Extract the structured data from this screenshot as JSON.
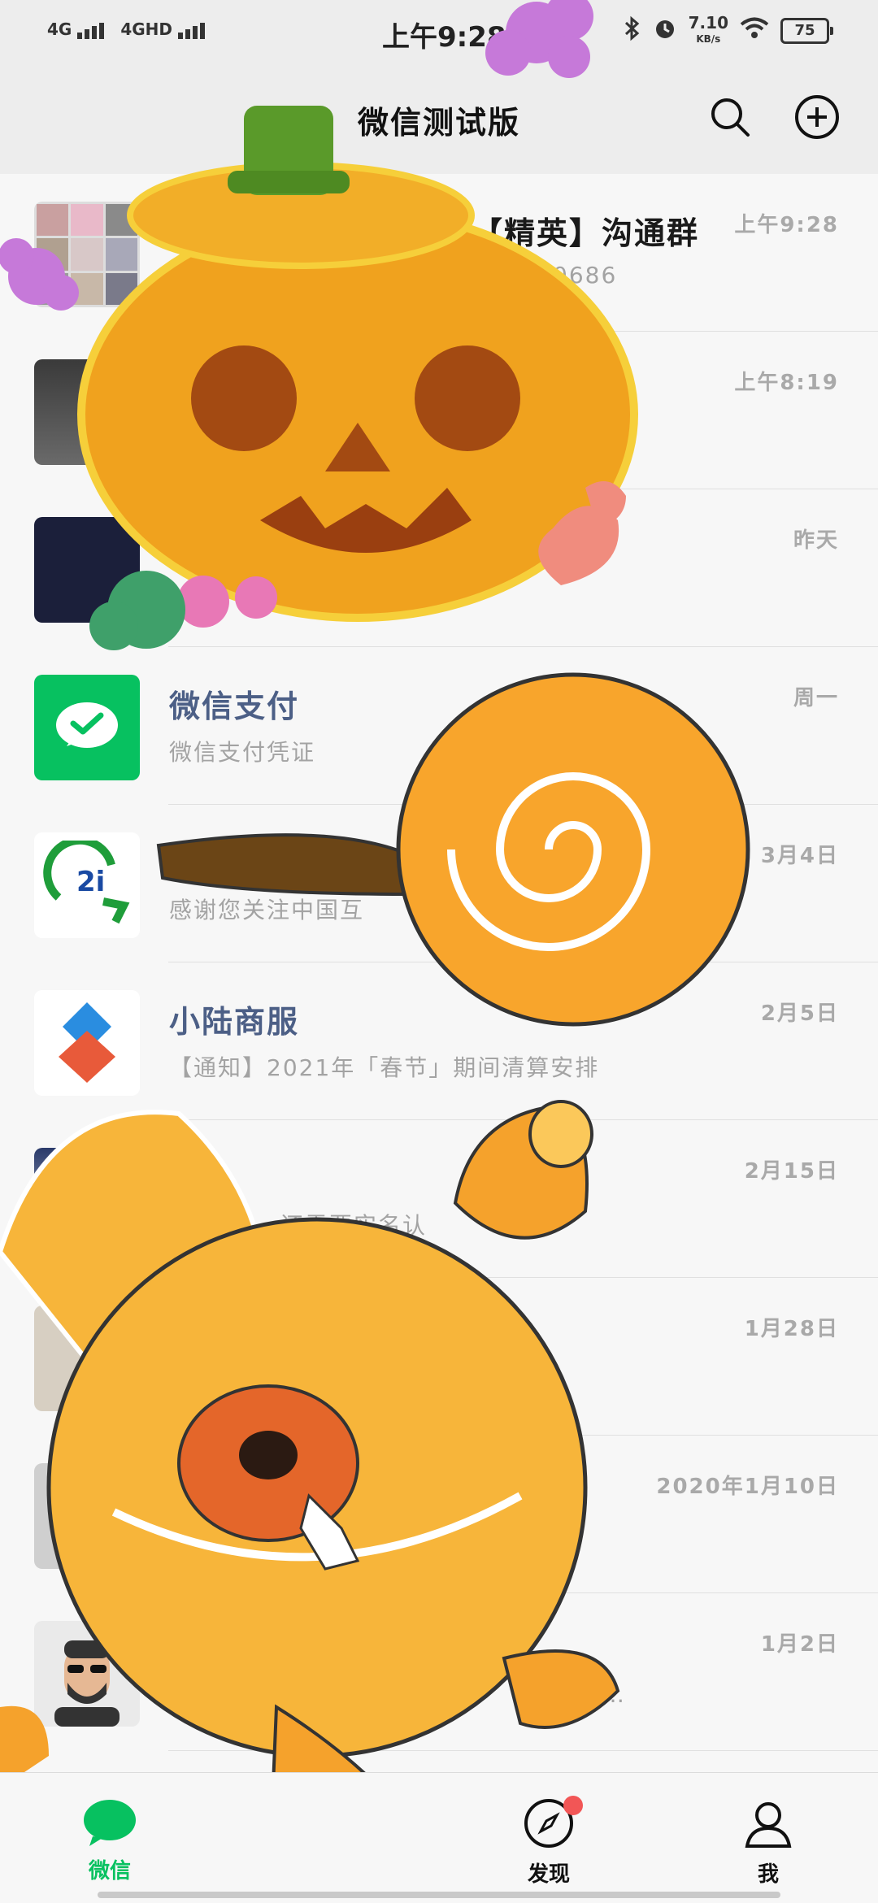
{
  "status_bar": {
    "signal_1": "4G",
    "signal_2": "4GHD",
    "time": "上午9:28",
    "net_speed": "7.10",
    "net_speed_unit": "KB/s",
    "battery": "75"
  },
  "header": {
    "title": "微信测试版",
    "search_icon": "search-icon",
    "add_icon": "plus-circle-icon"
  },
  "chats": [
    {
      "name": "【精英】沟通群",
      "preview": "0686",
      "time": "上午9:28"
    },
    {
      "name": "",
      "preview": "",
      "time": "上午8:19"
    },
    {
      "name": "",
      "preview": "",
      "time": "昨天"
    },
    {
      "name": "微信支付",
      "preview": "微信支付凭证",
      "time": "周一",
      "official": true
    },
    {
      "name": "",
      "preview": "感谢您关注中国互",
      "time": "3月4日"
    },
    {
      "name": "小陆商服",
      "preview": "【通知】2021年「春节」期间清算安排",
      "time": "2月5日",
      "official": true
    },
    {
      "name": "",
      "preview": "还需要实名认",
      "time": "2月15日"
    },
    {
      "name": "",
      "preview": "",
      "time": "1月28日"
    },
    {
      "name": "",
      "preview": "",
      "time": "2020年1月10日"
    },
    {
      "name": "",
      "preview": "…",
      "time": "1月2日"
    }
  ],
  "tabs": [
    {
      "label": "微信",
      "icon": "chat-bubble-icon",
      "active": true
    },
    {
      "label": "发现",
      "icon": "compass-icon",
      "badge": true
    },
    {
      "label": "我",
      "icon": "person-icon"
    }
  ],
  "colors": {
    "accent": "#07c160",
    "badge": "#f25656",
    "official_name": "#4c5f86"
  }
}
